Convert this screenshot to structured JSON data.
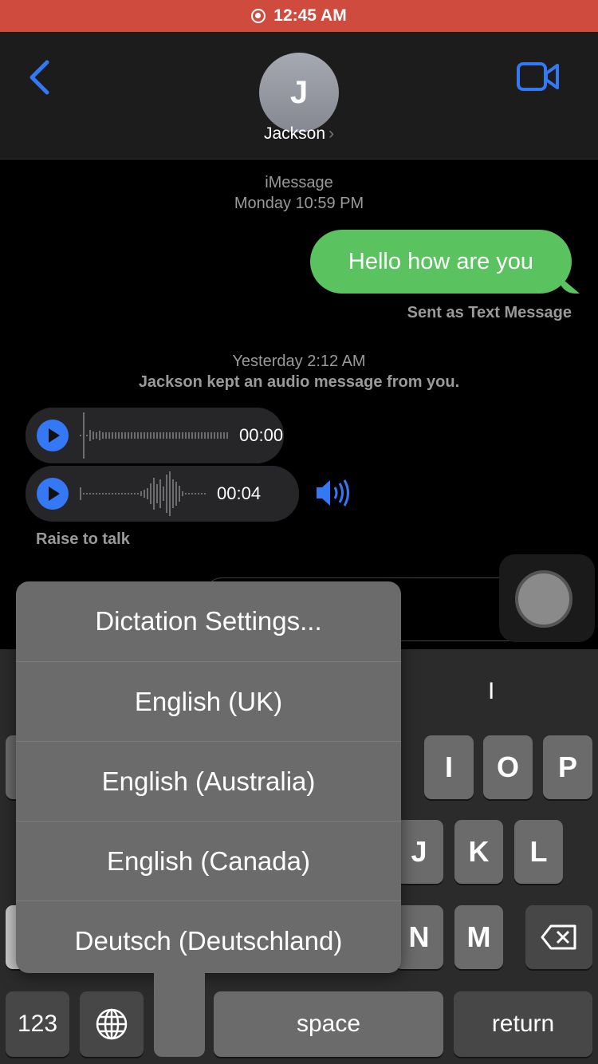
{
  "status": {
    "time": "12:45 AM",
    "recording_icon": "record-icon"
  },
  "header": {
    "contact_initial": "J",
    "contact_name": "Jackson",
    "back_icon": "chevron-left-icon",
    "video_icon": "video-camera-icon",
    "accent": "#3478f6"
  },
  "thread": {
    "service": "iMessage",
    "date1": "Monday 10:59 PM",
    "sent_message": "Hello how are you",
    "sent_status": "Sent as Text Message",
    "date2": "Yesterday 2:12 AM",
    "notice": "Jackson kept an audio message from you.",
    "audio": [
      {
        "time": "00:00"
      },
      {
        "time": "00:04"
      }
    ],
    "raise_to_talk": "Raise to talk"
  },
  "dictation_menu": {
    "items": [
      "Dictation Settings...",
      "English (UK)",
      "English (Australia)",
      "English (Canada)",
      "Deutsch (Deutschland)"
    ]
  },
  "keyboard": {
    "suggestion": "I",
    "row1": [
      "I",
      "O",
      "P"
    ],
    "row2": [
      "J",
      "K",
      "L"
    ],
    "row3": [
      "N",
      "M"
    ],
    "numbers": "123",
    "space": "space",
    "return": "return"
  }
}
